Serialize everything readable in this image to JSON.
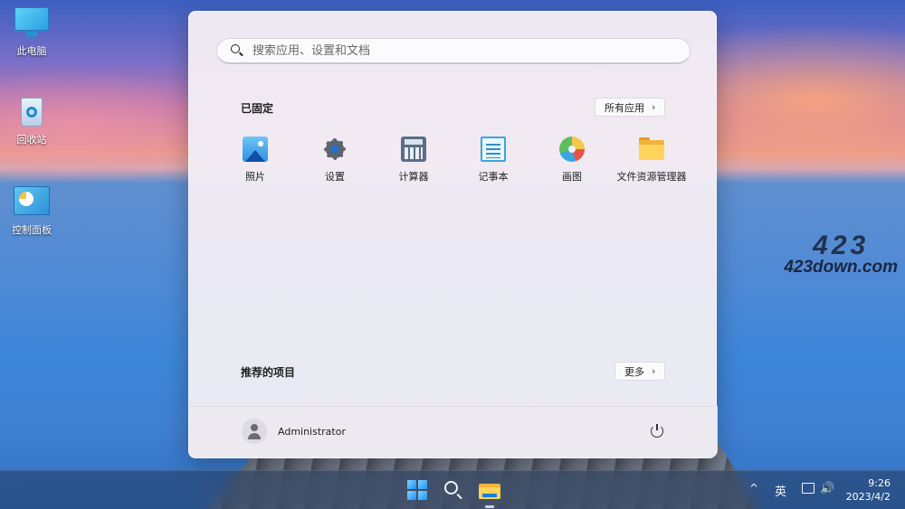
{
  "desktop": {
    "icons": [
      {
        "label": "此电脑",
        "icon": "this-pc-icon"
      },
      {
        "label": "回收站",
        "icon": "recycle-bin-icon"
      },
      {
        "label": "控制面板",
        "icon": "control-panel-icon"
      }
    ],
    "watermark": {
      "line1": "423",
      "line2": "423down.com"
    }
  },
  "start_menu": {
    "search": {
      "placeholder": "搜索应用、设置和文档",
      "icon": "search-icon"
    },
    "pinned": {
      "title": "已固定",
      "all_apps_label": "所有应用",
      "apps": [
        {
          "label": "照片",
          "icon": "photos-icon"
        },
        {
          "label": "设置",
          "icon": "settings-gear-icon"
        },
        {
          "label": "计算器",
          "icon": "calculator-icon"
        },
        {
          "label": "记事本",
          "icon": "notepad-icon"
        },
        {
          "label": "画图",
          "icon": "paint-palette-icon"
        },
        {
          "label": "文件资源管理器",
          "icon": "file-explorer-folder-icon"
        }
      ]
    },
    "recommended": {
      "title": "推荐的项目",
      "more_label": "更多"
    },
    "footer": {
      "user_name": "Administrator",
      "power_icon": "power-icon"
    }
  },
  "taskbar": {
    "items": [
      "start-windows-icon",
      "search-icon",
      "file-explorer-icon"
    ],
    "tray": {
      "chevron": "^",
      "ime": "英",
      "volume_glyph": "🔊",
      "time": "9:26",
      "date": "2023/4/2"
    }
  },
  "colors": {
    "accent": "#1e90ff",
    "menu_bg": "#f1ecf4",
    "taskbar_bg": "#263a5c"
  }
}
